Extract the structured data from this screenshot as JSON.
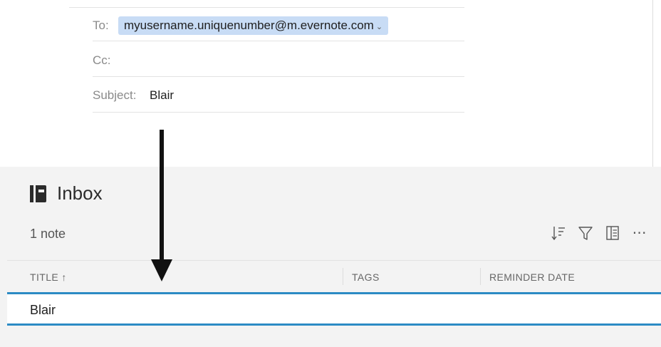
{
  "compose": {
    "to_label": "To:",
    "to_address": "myusername.uniquenumber@m.evernote.com",
    "cc_label": "Cc:",
    "subject_label": "Subject:",
    "subject_value": "Blair"
  },
  "notebook": {
    "icon": "notebook-icon",
    "title": "Inbox",
    "note_count": "1 note",
    "toolbar_icons": [
      "sort-icon",
      "filter-icon",
      "view-icon",
      "more-icon"
    ]
  },
  "table": {
    "columns": [
      "TITLE ↑",
      "TAGS",
      "REMINDER DATE"
    ],
    "rows": [
      {
        "title": "Blair"
      }
    ]
  },
  "colors": {
    "selection_border": "#2c8bc4",
    "address_token_bg": "#c8dcf5",
    "list_background": "#f3f3f3"
  }
}
